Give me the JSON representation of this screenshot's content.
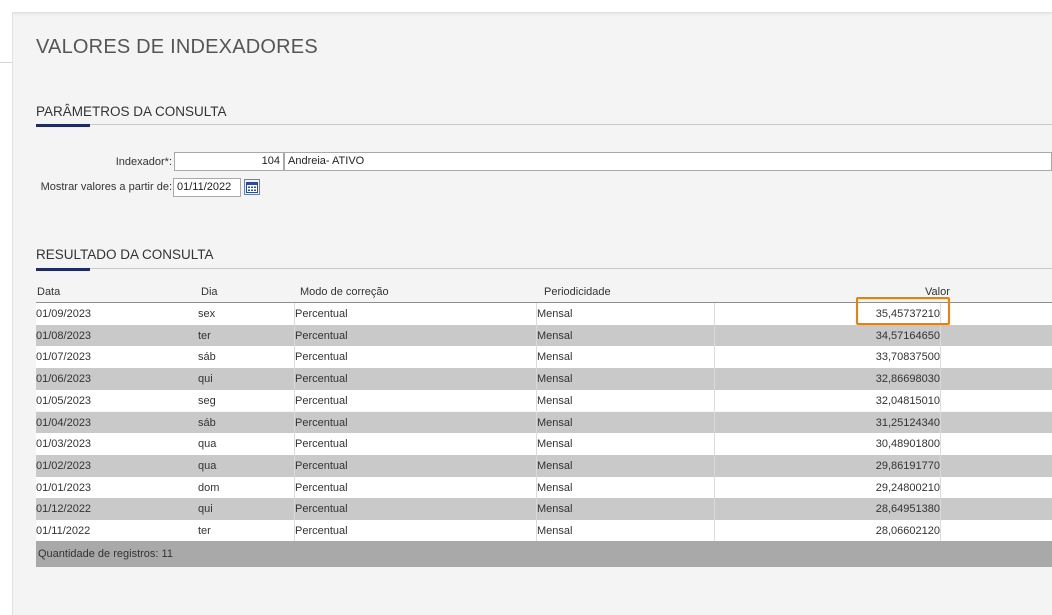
{
  "page": {
    "title": "VALORES DE INDEXADORES"
  },
  "params": {
    "section_title": "PARÂMETROS DA CONSULTA",
    "indexador_label": "Indexador*:",
    "indexador_code": "104",
    "indexador_desc": "Andreia- ATIVO",
    "date_label": "Mostrar valores a partir de:",
    "date_value": "01/11/2022"
  },
  "results": {
    "section_title": "RESULTADO DA CONSULTA",
    "columns": {
      "data": "Data",
      "dia": "Dia",
      "modo": "Modo de correção",
      "periodicidade": "Periodicidade",
      "valor": "Valor"
    },
    "rows": [
      {
        "data": "01/09/2023",
        "dia": "sex",
        "modo": "Percentual",
        "periodicidade": "Mensal",
        "valor": "35,45737210"
      },
      {
        "data": "01/08/2023",
        "dia": "ter",
        "modo": "Percentual",
        "periodicidade": "Mensal",
        "valor": "34,57164650"
      },
      {
        "data": "01/07/2023",
        "dia": "sáb",
        "modo": "Percentual",
        "periodicidade": "Mensal",
        "valor": "33,70837500"
      },
      {
        "data": "01/06/2023",
        "dia": "qui",
        "modo": "Percentual",
        "periodicidade": "Mensal",
        "valor": "32,86698030"
      },
      {
        "data": "01/05/2023",
        "dia": "seg",
        "modo": "Percentual",
        "periodicidade": "Mensal",
        "valor": "32,04815010"
      },
      {
        "data": "01/04/2023",
        "dia": "sáb",
        "modo": "Percentual",
        "periodicidade": "Mensal",
        "valor": "31,25124340"
      },
      {
        "data": "01/03/2023",
        "dia": "qua",
        "modo": "Percentual",
        "periodicidade": "Mensal",
        "valor": "30,48901800"
      },
      {
        "data": "01/02/2023",
        "dia": "qua",
        "modo": "Percentual",
        "periodicidade": "Mensal",
        "valor": "29,86191770"
      },
      {
        "data": "01/01/2023",
        "dia": "dom",
        "modo": "Percentual",
        "periodicidade": "Mensal",
        "valor": "29,24800210"
      },
      {
        "data": "01/12/2022",
        "dia": "qui",
        "modo": "Percentual",
        "periodicidade": "Mensal",
        "valor": "28,64951380"
      },
      {
        "data": "01/11/2022",
        "dia": "ter",
        "modo": "Percentual",
        "periodicidade": "Mensal",
        "valor": "28,06602120"
      }
    ],
    "footer_text": "Quantidade de registros: 11"
  },
  "colors": {
    "accent": "#1f2a6b",
    "highlight": "#f57c00",
    "row_alt": "#c9c9c9"
  }
}
